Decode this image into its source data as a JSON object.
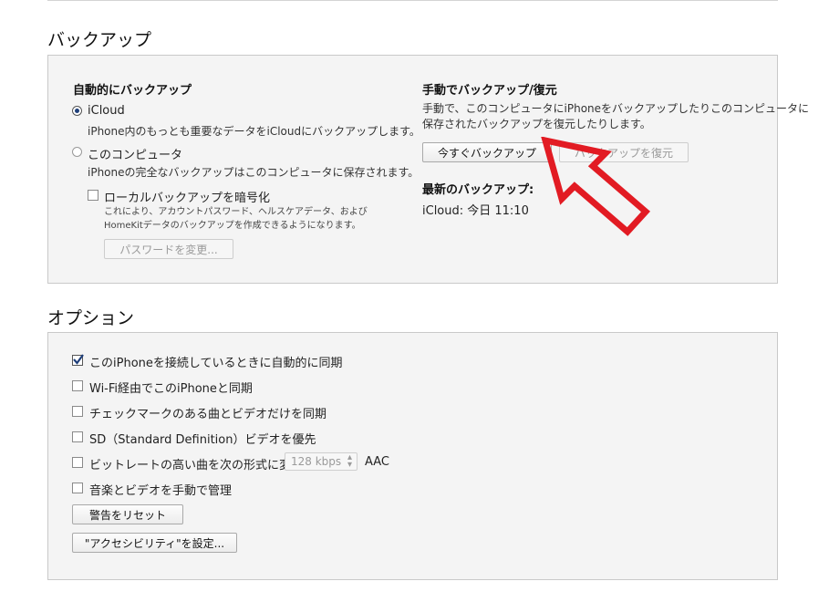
{
  "backup": {
    "title": "バックアップ",
    "auto": {
      "heading": "自動的にバックアップ",
      "icloud_label": "iCloud",
      "icloud_desc": "iPhone内のもっとも重要なデータをiCloudにバックアップします。",
      "icloud_selected": true,
      "computer_label": "このコンピュータ",
      "computer_desc": "iPhoneの完全なバックアップはこのコンピュータに保存されます。",
      "computer_selected": false,
      "encrypt_label": "ローカルバックアップを暗号化",
      "encrypt_checked": false,
      "encrypt_desc": "これにより、アカウントパスワード、ヘルスケアデータ、およびHomeKitデータのバックアップを作成できるようになります。",
      "change_password_label": "パスワードを変更..."
    },
    "manual": {
      "heading": "手動でバックアップ/復元",
      "desc_line1": "手動で、このコンピュータにiPhoneをバックアップしたりこのコンピュータに",
      "desc_line2": "保存されたバックアップを復元したりします。",
      "backup_now_label": "今すぐバックアップ",
      "restore_label": "バックアップを復元",
      "latest_heading": "最新のバックアップ:",
      "latest_value": "iCloud: 今日 11:10"
    }
  },
  "options": {
    "title": "オプション",
    "items": [
      {
        "label": "このiPhoneを接続しているときに自動的に同期",
        "checked": true
      },
      {
        "label": "Wi-Fi経由でこのiPhoneと同期",
        "checked": false
      },
      {
        "label": "チェックマークのある曲とビデオだけを同期",
        "checked": false
      },
      {
        "label": "SD（Standard Definition）ビデオを優先",
        "checked": false
      },
      {
        "label": "ビットレートの高い曲を次の形式に変換:",
        "checked": false
      },
      {
        "label": "音楽とビデオを手動で管理",
        "checked": false
      }
    ],
    "bitrate_value": "128 kbps",
    "bitrate_format": "AAC",
    "reset_warnings_label": "警告をリセット",
    "accessibility_label": "\"アクセシビリティ\"を設定..."
  },
  "colors": {
    "annotation_arrow": "#e21b23",
    "checkbox_check": "#1f3f7a"
  }
}
